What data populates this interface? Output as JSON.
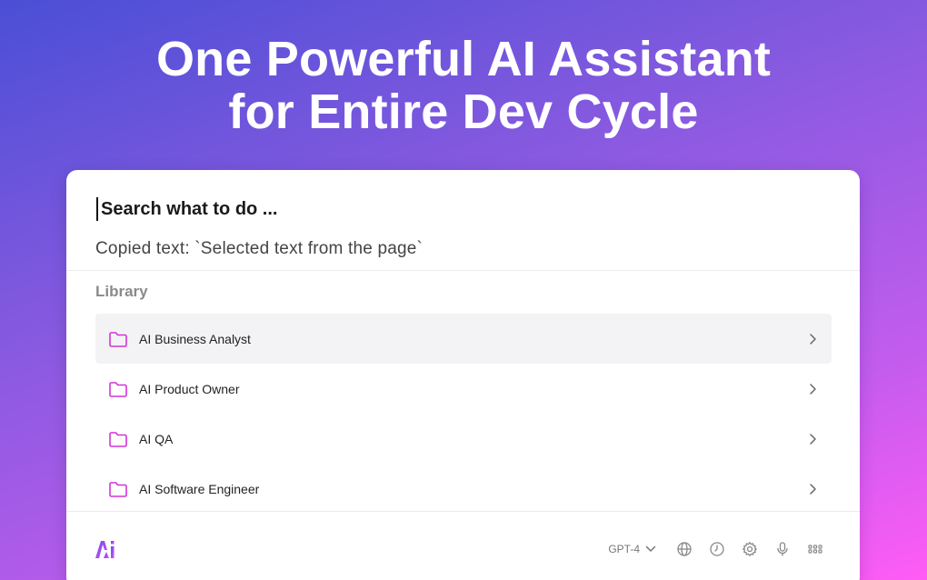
{
  "hero": {
    "line1": "One Powerful AI Assistant",
    "line2": "for Entire Dev Cycle"
  },
  "search": {
    "placeholder": "Search what to do ..."
  },
  "copied_text": "Copied text: `Selected text from the page`",
  "library": {
    "label": "Library",
    "items": [
      {
        "label": "AI Business Analyst",
        "icon": "folder-icon"
      },
      {
        "label": "AI Product Owner",
        "icon": "folder-icon"
      },
      {
        "label": "AI QA",
        "icon": "folder-icon"
      },
      {
        "label": "AI Software Engineer",
        "icon": "folder-icon"
      }
    ]
  },
  "toolbar": {
    "model": "GPT-4",
    "icons": [
      "globe-icon",
      "history-icon",
      "settings-icon",
      "microphone-icon",
      "apps-grid-icon"
    ]
  },
  "colors": {
    "accent": "#d633d6",
    "gradient_start": "#4a4fd6",
    "gradient_end": "#ff5cf5"
  }
}
